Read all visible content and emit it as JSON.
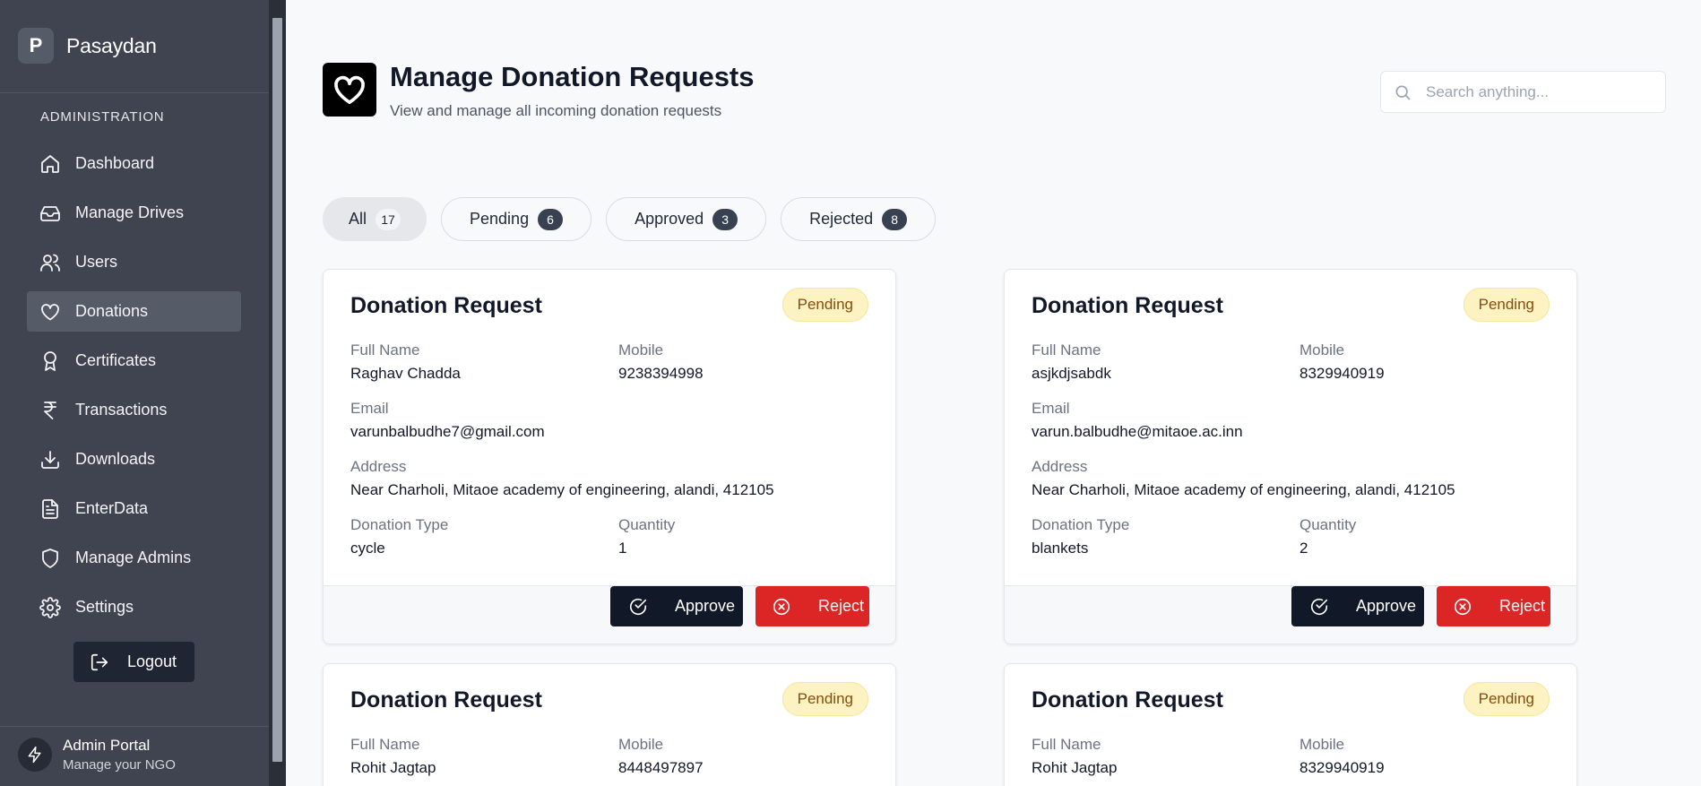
{
  "brand": {
    "logo_letter": "P",
    "name": "Pasaydan"
  },
  "sidebar": {
    "section_label": "ADMINISTRATION",
    "items": [
      {
        "label": "Dashboard",
        "icon": "home-icon",
        "active": false
      },
      {
        "label": "Manage Drives",
        "icon": "inbox-icon",
        "active": false
      },
      {
        "label": "Users",
        "icon": "users-icon",
        "active": false
      },
      {
        "label": "Donations",
        "icon": "heart-icon",
        "active": true
      },
      {
        "label": "Certificates",
        "icon": "award-icon",
        "active": false
      },
      {
        "label": "Transactions",
        "icon": "rupee-icon",
        "active": false
      },
      {
        "label": "Downloads",
        "icon": "download-icon",
        "active": false
      },
      {
        "label": "EnterData",
        "icon": "file-text-icon",
        "active": false
      },
      {
        "label": "Manage Admins",
        "icon": "shield-icon",
        "active": false
      },
      {
        "label": "Settings",
        "icon": "gear-icon",
        "active": false
      }
    ],
    "logout_label": "Logout",
    "portal": {
      "title": "Admin Portal",
      "subtitle": "Manage your NGO"
    }
  },
  "header": {
    "title": "Manage Donation Requests",
    "subtitle": "View and manage all incoming donation requests",
    "search_placeholder": "Search anything..."
  },
  "tabs": [
    {
      "label": "All",
      "count": "17",
      "active": true
    },
    {
      "label": "Pending",
      "count": "6",
      "active": false
    },
    {
      "label": "Approved",
      "count": "3",
      "active": false
    },
    {
      "label": "Rejected",
      "count": "8",
      "active": false
    }
  ],
  "labels": {
    "full_name": "Full Name",
    "mobile": "Mobile",
    "email": "Email",
    "address": "Address",
    "donation_type": "Donation Type",
    "quantity": "Quantity",
    "approve": "Approve",
    "reject": "Reject"
  },
  "cards": [
    {
      "title": "Donation Request",
      "status": "Pending",
      "full_name": "Raghav Chadda",
      "mobile": "9238394998",
      "email": "varunbalbudhe7@gmail.com",
      "address": "Near Charholi, Mitaoe academy of engineering, alandi, 412105",
      "donation_type": "cycle",
      "quantity": "1"
    },
    {
      "title": "Donation Request",
      "status": "Pending",
      "full_name": "asjkdjsabdk",
      "mobile": "8329940919",
      "email": "varun.balbudhe@mitaoe.ac.inn",
      "address": "Near Charholi, Mitaoe academy of engineering, alandi, 412105",
      "donation_type": "blankets",
      "quantity": "2"
    },
    {
      "title": "Donation Request",
      "status": "Pending",
      "full_name": "Rohit Jagtap",
      "mobile": "8448497897"
    },
    {
      "title": "Donation Request",
      "status": "Pending",
      "full_name": "Rohit Jagtap",
      "mobile": "8329940919"
    }
  ],
  "colors": {
    "sidebar_bg": "#3f4450",
    "active_nav_bg": "#565b68",
    "approve_bg": "#111827",
    "reject_bg": "#dc2626",
    "pending_badge_bg": "#fdf3c2"
  }
}
